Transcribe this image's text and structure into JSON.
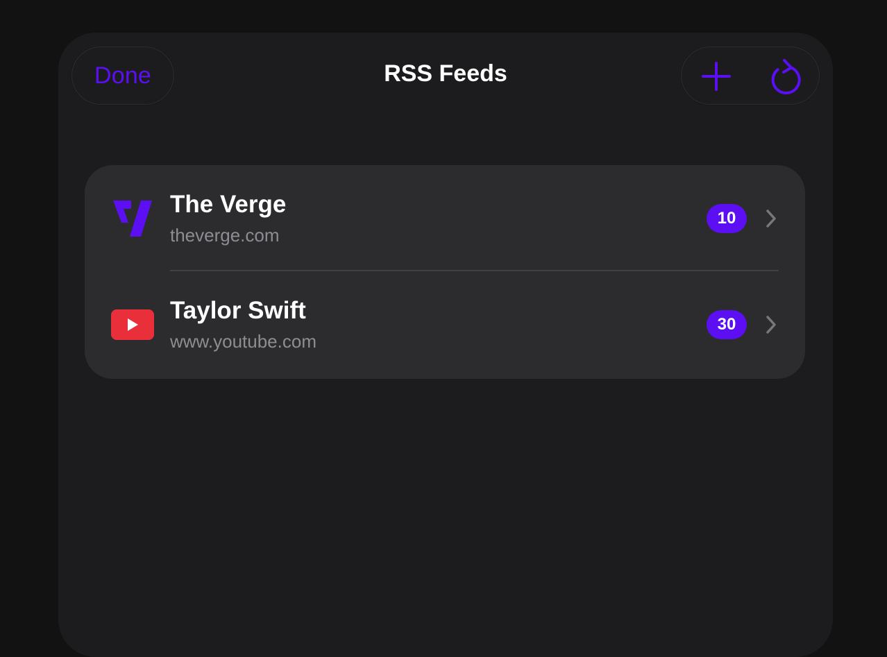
{
  "colors": {
    "accent": "#5b0ff2",
    "youtube_red": "#e9303a",
    "verge_purple": "#5b0ff2"
  },
  "header": {
    "title": "RSS Feeds",
    "done_label": "Done",
    "add_icon": "plus-icon",
    "refresh_icon": "refresh-icon"
  },
  "feeds": [
    {
      "name": "The Verge",
      "url": "theverge.com",
      "unread_count": "10",
      "icon": "verge-logo-icon"
    },
    {
      "name": "Taylor Swift",
      "url": "www.youtube.com",
      "unread_count": "30",
      "icon": "youtube-logo-icon"
    }
  ]
}
